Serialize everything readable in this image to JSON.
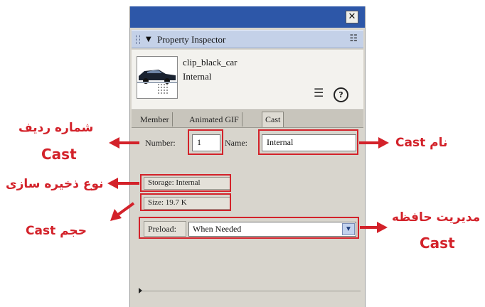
{
  "window": {
    "close_glyph": "✕"
  },
  "panel": {
    "title": "Property Inspector",
    "collapse_glyph": "▼",
    "options_glyph": "☷",
    "member_name": "clip_black_car",
    "cast_name": "Internal",
    "list_glyph": "☰",
    "help_glyph": "?",
    "tabs": [
      {
        "label": "Member",
        "active": false
      },
      {
        "label": "Animated GIF",
        "active": false
      },
      {
        "label": "Cast",
        "active": true
      }
    ],
    "fields": {
      "number_label": "Number:",
      "number_value": "1",
      "name_label": "Name:",
      "name_value": "Internal",
      "storage": "Storage: Internal",
      "size": "Size: 19.7 K",
      "preload_label": "Preload:",
      "preload_value": "When Needed",
      "dropdown_glyph": "▼"
    }
  },
  "annotations": {
    "number_fa": "شماره ردیف",
    "number_en": "Cast",
    "name": "نام Cast",
    "storage": "نوع ذخیره سازی",
    "size": "حجم Cast",
    "preload_fa": "مدیریت حافظه",
    "preload_en": "Cast",
    "color": "#d3222a"
  }
}
